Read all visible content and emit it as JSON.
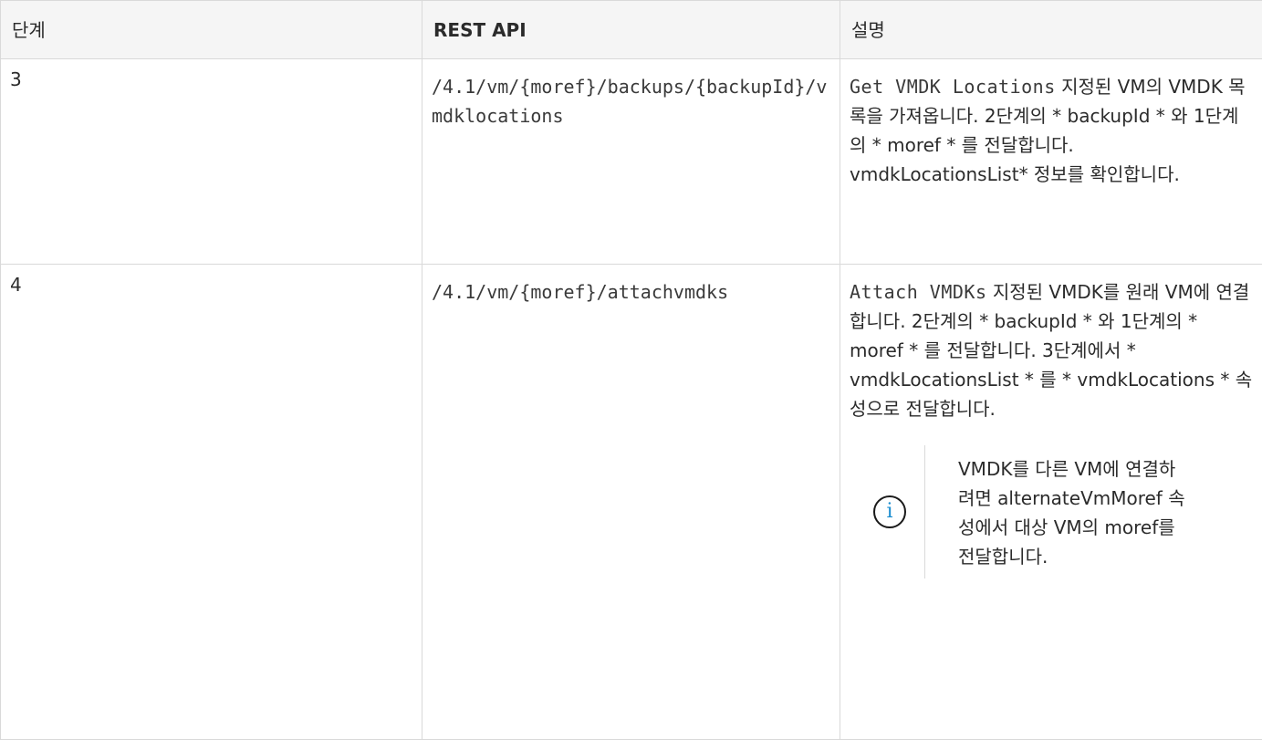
{
  "table": {
    "headers": [
      "단계",
      "REST API",
      "설명"
    ],
    "rows": [
      {
        "step": "3",
        "api": "/4.1/vm/{moref}/backups/{backupId}/vmdklocations",
        "desc_code": "Get VMDK Locations",
        "desc_text": "지정된 VM의 VMDK 목록을 가져옵니다. 2단계의 * backupId * 와 1단계의 * moref * 를 전달합니다. vmdkLocationsList* 정보를 확인합니다."
      },
      {
        "step": "4",
        "api": "/4.1/vm/{moref}/attachvmdks",
        "desc_code": "Attach VMDKs",
        "desc_text": "지정된 VMDK를 원래 VM에 연결합니다. 2단계의 * backupId * 와 1단계의 * moref * 를 전달합니다. 3단계에서 * vmdkLocationsList * 를 * vmdkLocations * 속성으로 전달합니다.",
        "note": {
          "icon": "info-icon",
          "glyph": "i",
          "text": "VMDK를 다른 VM에 연결하려면 alternateVmMoref 속성에서 대상 VM의 moref를 전달합니다."
        }
      }
    ]
  }
}
